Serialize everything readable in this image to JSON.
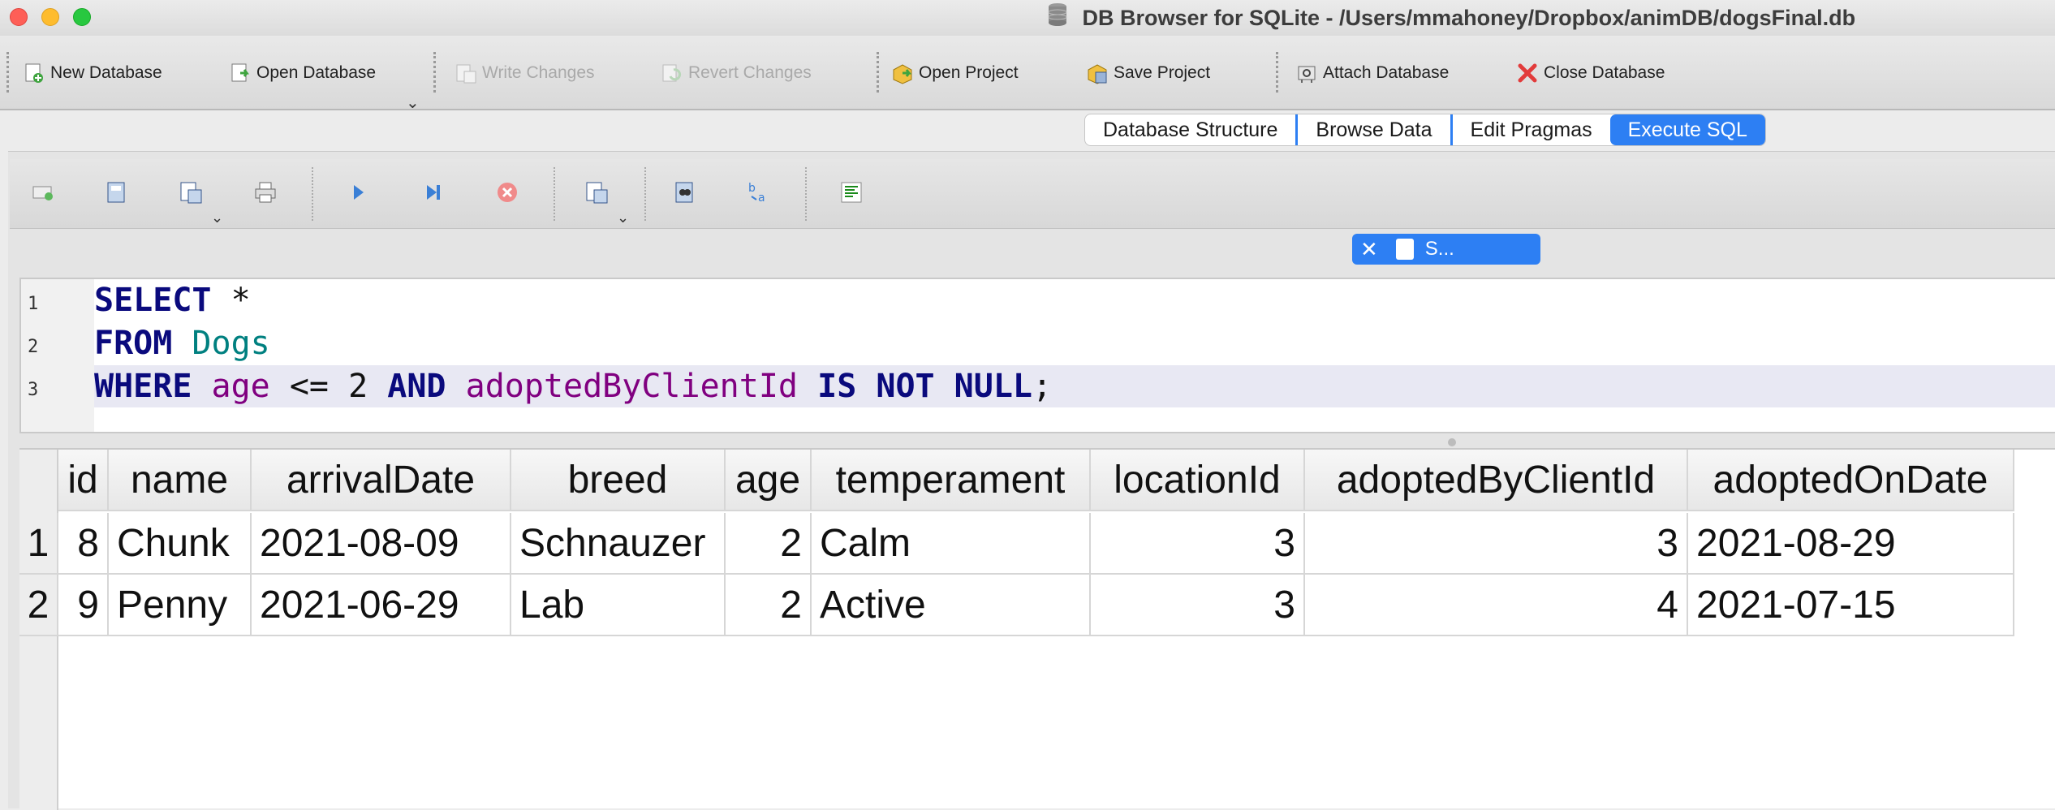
{
  "window": {
    "title": "DB Browser for SQLite - /Users/mmahoney/Dropbox/animDB/dogsFinal.db"
  },
  "toolbar": {
    "new_database": "New Database",
    "open_database": "Open Database",
    "write_changes": "Write Changes",
    "revert_changes": "Revert Changes",
    "open_project": "Open Project",
    "save_project": "Save Project",
    "attach_database": "Attach Database",
    "close_database": "Close Database"
  },
  "tabs": [
    {
      "label": "Database Structure"
    },
    {
      "label": "Browse Data"
    },
    {
      "label": "Edit Pragmas"
    },
    {
      "label": "Execute SQL",
      "active": true
    }
  ],
  "sql_tab": {
    "label": "S..."
  },
  "editor": {
    "line_numbers": [
      "1",
      "2",
      "3"
    ],
    "lines": [
      {
        "tokens": [
          {
            "t": "SELECT",
            "k": "kw"
          },
          {
            "t": " *",
            "k": "plain"
          }
        ]
      },
      {
        "tokens": [
          {
            "t": "FROM",
            "k": "kw"
          },
          {
            "t": " ",
            "k": "plain"
          },
          {
            "t": "Dogs",
            "k": "tbl"
          }
        ]
      },
      {
        "tokens": [
          {
            "t": "WHERE",
            "k": "kw"
          },
          {
            "t": " ",
            "k": "plain"
          },
          {
            "t": "age",
            "k": "col"
          },
          {
            "t": " <= 2 ",
            "k": "plain"
          },
          {
            "t": "AND",
            "k": "kw"
          },
          {
            "t": " ",
            "k": "plain"
          },
          {
            "t": "adoptedByClientId",
            "k": "col"
          },
          {
            "t": " ",
            "k": "plain"
          },
          {
            "t": "IS NOT NULL",
            "k": "kw"
          },
          {
            "t": ";",
            "k": "plain"
          }
        ]
      }
    ]
  },
  "results": {
    "columns": [
      "id",
      "name",
      "arrivalDate",
      "breed",
      "age",
      "temperament",
      "locationId",
      "adoptedByClientId",
      "adoptedOnDate"
    ],
    "rows": [
      {
        "row_number": "1",
        "cells": [
          "8",
          "Chunk",
          "2021-08-09",
          "Schnauzer",
          "2",
          "Calm",
          "3",
          "3",
          "2021-08-29"
        ]
      },
      {
        "row_number": "2",
        "cells": [
          "9",
          "Penny",
          "2021-06-29",
          "Lab",
          "2",
          "Active",
          "3",
          "4",
          "2021-07-15"
        ]
      }
    ]
  },
  "colors": {
    "accent": "#2d7ff3",
    "keyword": "#0a0a7d",
    "table_name": "#008080",
    "column_name": "#800080"
  }
}
